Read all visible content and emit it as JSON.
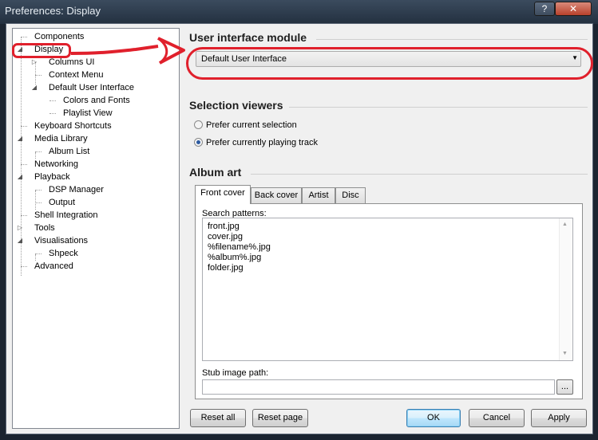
{
  "window": {
    "title": "Preferences: Display",
    "help_label": "?",
    "close_label": "✕"
  },
  "tree": {
    "items": [
      {
        "label": "Components"
      },
      {
        "label": "Display"
      },
      {
        "label": "Columns UI"
      },
      {
        "label": "Context Menu"
      },
      {
        "label": "Default User Interface"
      },
      {
        "label": "Colors and Fonts"
      },
      {
        "label": "Playlist View"
      },
      {
        "label": "Keyboard Shortcuts"
      },
      {
        "label": "Media Library"
      },
      {
        "label": "Album List"
      },
      {
        "label": "Networking"
      },
      {
        "label": "Playback"
      },
      {
        "label": "DSP Manager"
      },
      {
        "label": "Output"
      },
      {
        "label": "Shell Integration"
      },
      {
        "label": "Tools"
      },
      {
        "label": "Visualisations"
      },
      {
        "label": "Shpeck"
      },
      {
        "label": "Advanced"
      }
    ],
    "expanded_glyph": "◢",
    "collapsed_glyph": "▷",
    "selected": "Display"
  },
  "ui_module": {
    "title": "User interface module",
    "selected": "Default User Interface",
    "arrow": "▼"
  },
  "selection_viewers": {
    "title": "Selection viewers",
    "options": [
      {
        "label": "Prefer current selection",
        "checked": false
      },
      {
        "label": "Prefer currently playing track",
        "checked": true
      }
    ]
  },
  "album_art": {
    "title": "Album art",
    "tabs": [
      {
        "label": "Front cover",
        "active": true
      },
      {
        "label": "Back cover",
        "active": false
      },
      {
        "label": "Artist",
        "active": false
      },
      {
        "label": "Disc",
        "active": false
      }
    ],
    "search_patterns_label": "Search patterns:",
    "patterns": [
      "front.jpg",
      "cover.jpg",
      "%filename%.jpg",
      "%album%.jpg",
      "folder.jpg"
    ],
    "stub_label": "Stub image path:",
    "stub_value": "",
    "browse_label": "...",
    "scroll_up": "▲",
    "scroll_down": "▼"
  },
  "buttons": {
    "reset_all": "Reset all",
    "reset_page": "Reset page",
    "ok": "OK",
    "cancel": "Cancel",
    "apply": "Apply"
  },
  "colors": {
    "annotation_red": "#e0202c",
    "selected_radio": "#2c5aa0"
  }
}
